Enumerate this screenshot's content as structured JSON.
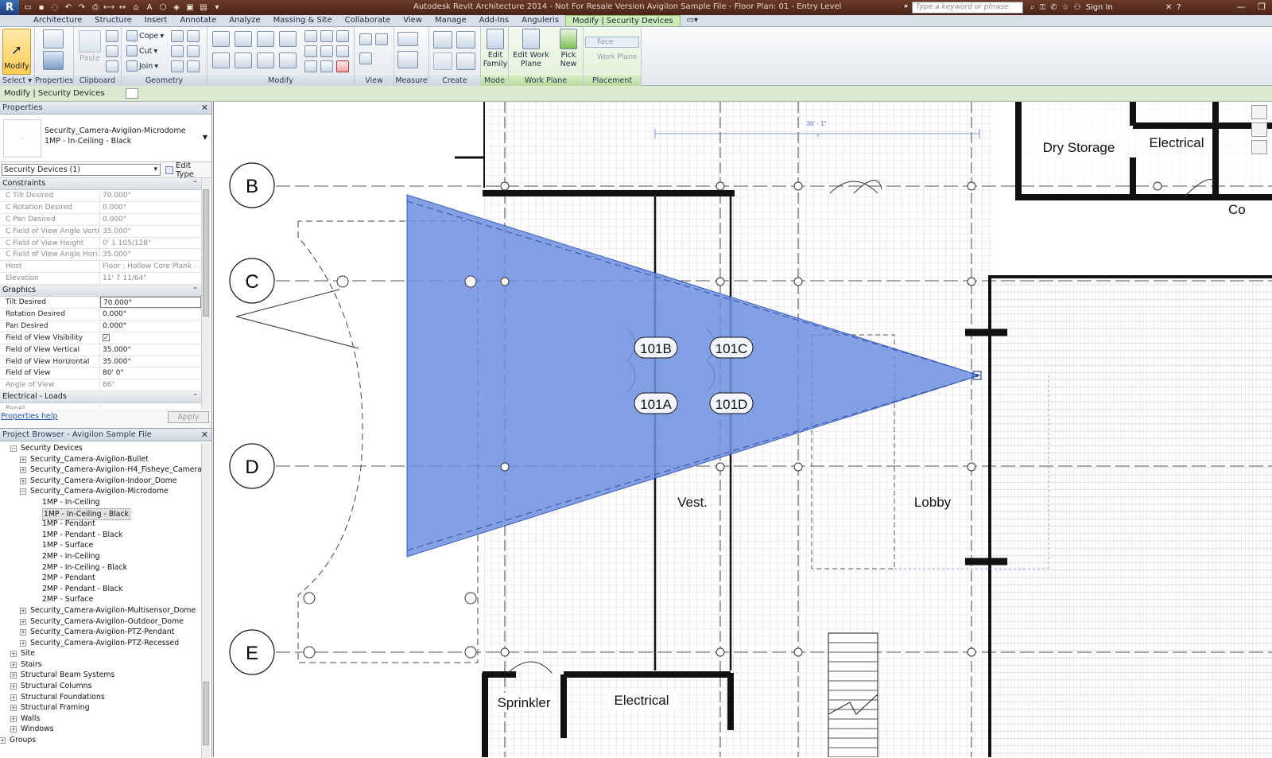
{
  "window": {
    "title": "Autodesk Revit Architecture 2014 - Not For Resale Version    Avigilon Sample File - Floor Plan: 01 - Entry Level",
    "search_placeholder": "Type a keyword or phrase",
    "sign_in": "Sign In"
  },
  "ribbon_tabs": [
    "Architecture",
    "Structure",
    "Insert",
    "Annotate",
    "Analyze",
    "Massing & Site",
    "Collaborate",
    "View",
    "Manage",
    "Add-Ins",
    "Anguleris",
    "Modify | Security Devices"
  ],
  "ribbon": {
    "modify_label": "Modify",
    "select_label": "Select",
    "properties_label": "Properties",
    "clipboard_label": "Clipboard",
    "paste_label": "Paste",
    "cope_label": "Cope",
    "cut_label": "Cut",
    "join_label": "Join",
    "geometry_label": "Geometry",
    "modify_panel_label": "Modify",
    "view_label": "View",
    "measure_label": "Measure",
    "create_label": "Create",
    "edit_family_label": "Edit Family",
    "mode_label": "Mode",
    "edit_work_plane_label": "Edit Work Plane",
    "pick_new_label": "Pick New",
    "work_plane_label": "Work Plane",
    "face_label": "Face",
    "work_plane_btn_label": "Work Plane",
    "placement_label": "Placement"
  },
  "options_bar": {
    "context": "Modify | Security Devices"
  },
  "properties": {
    "title": "Properties",
    "type_name_line1": "Security_Camera-Avigilon-Microdome",
    "type_name_line2": "1MP - In-Ceiling - Black",
    "instance_filter": "Security Devices (1)",
    "edit_type": "Edit Type",
    "groups": [
      {
        "name": "Constraints",
        "rows": [
          {
            "name": "C Tilt Desired",
            "value": "70.000°",
            "readonly": true
          },
          {
            "name": "C Rotation Desired",
            "value": "0.000°",
            "readonly": true
          },
          {
            "name": "C Pan Desired",
            "value": "0.000°",
            "readonly": true
          },
          {
            "name": "C Field of View Angle Verti...",
            "value": "35.000°",
            "readonly": true
          },
          {
            "name": "C Field of View Height",
            "value": "0'  1 105/128\"",
            "readonly": true
          },
          {
            "name": "C Field of View Angle Hori...",
            "value": "35.000°",
            "readonly": true
          },
          {
            "name": "Host",
            "value": "Floor : Hollow Core Plank - ...",
            "readonly": true
          },
          {
            "name": "Elevation",
            "value": "11'  7 11/64\"",
            "readonly": true
          }
        ]
      },
      {
        "name": "Graphics",
        "rows": [
          {
            "name": "Tilt Desired",
            "value": "70.000°",
            "readonly": false,
            "editing": true
          },
          {
            "name": "Rotation Desired",
            "value": "0.000°",
            "readonly": false
          },
          {
            "name": "Pan Desired",
            "value": "0.000°",
            "readonly": false
          },
          {
            "name": "Field of View Visibility",
            "value": "✓",
            "readonly": false,
            "checkbox": true
          },
          {
            "name": "Field of View Vertical",
            "value": "35.000°",
            "readonly": false
          },
          {
            "name": "Field of View Horizontal",
            "value": "35.000°",
            "readonly": false
          },
          {
            "name": "Field of View",
            "value": "80'  0\"",
            "readonly": false
          },
          {
            "name": "Angle of View",
            "value": "86°",
            "readonly": true
          }
        ]
      },
      {
        "name": "Electrical - Loads",
        "rows": [
          {
            "name": "Panel",
            "value": "",
            "readonly": true
          }
        ]
      }
    ],
    "help_link": "Properties help",
    "apply_label": "Apply"
  },
  "project_browser": {
    "title": "Project Browser - Avigilon Sample File",
    "nodes": [
      {
        "label": "Security Devices",
        "level": 1,
        "expander": "−"
      },
      {
        "label": "Security_Camera-Avigilon-Bullet",
        "level": 2,
        "expander": "+"
      },
      {
        "label": "Security_Camera-Avigilon-H4_Fisheye_Camera",
        "level": 2,
        "expander": "+"
      },
      {
        "label": "Security_Camera-Avigilon-Indoor_Dome",
        "level": 2,
        "expander": "+"
      },
      {
        "label": "Security_Camera-Avigilon-Microdome",
        "level": 2,
        "expander": "−"
      },
      {
        "label": "1MP - In-Ceiling",
        "level": 3,
        "expander": ""
      },
      {
        "label": "1MP - In-Ceiling - Black",
        "level": 3,
        "expander": "",
        "selected": true
      },
      {
        "label": "1MP - Pendant",
        "level": 3,
        "expander": ""
      },
      {
        "label": "1MP - Pendant - Black",
        "level": 3,
        "expander": ""
      },
      {
        "label": "1MP - Surface",
        "level": 3,
        "expander": ""
      },
      {
        "label": "2MP - In-Ceiling",
        "level": 3,
        "expander": ""
      },
      {
        "label": "2MP - In-Ceiling - Black",
        "level": 3,
        "expander": ""
      },
      {
        "label": "2MP - Pendant",
        "level": 3,
        "expander": ""
      },
      {
        "label": "2MP - Pendant - Black",
        "level": 3,
        "expander": ""
      },
      {
        "label": "2MP - Surface",
        "level": 3,
        "expander": ""
      },
      {
        "label": "Security_Camera-Avigilon-Multisensor_Dome",
        "level": 2,
        "expander": "+"
      },
      {
        "label": "Security_Camera-Avigilon-Outdoor_Dome",
        "level": 2,
        "expander": "+"
      },
      {
        "label": "Security_Camera-Avigilon-PTZ-Pendant",
        "level": 2,
        "expander": "+"
      },
      {
        "label": "Security_Camera-Avigilon-PTZ-Recessed",
        "level": 2,
        "expander": "+"
      },
      {
        "label": "Site",
        "level": 1,
        "expander": "+"
      },
      {
        "label": "Stairs",
        "level": 1,
        "expander": "+"
      },
      {
        "label": "Structural Beam Systems",
        "level": 1,
        "expander": "+"
      },
      {
        "label": "Structural Columns",
        "level": 1,
        "expander": "+"
      },
      {
        "label": "Structural Foundations",
        "level": 1,
        "expander": "+"
      },
      {
        "label": "Structural Framing",
        "level": 1,
        "expander": "+"
      },
      {
        "label": "Walls",
        "level": 1,
        "expander": "+"
      },
      {
        "label": "Windows",
        "level": 1,
        "expander": "+"
      },
      {
        "label": "Groups",
        "level": 0,
        "expander": "+"
      }
    ]
  },
  "drawing": {
    "grid_bubbles": [
      "B",
      "C",
      "D",
      "E"
    ],
    "rooms": [
      "Dry Storage",
      "Electrical",
      "Co",
      "Vest.",
      "Lobby",
      "Sprinkler",
      "Electrical"
    ],
    "door_tags": [
      "101B",
      "101C",
      "101A",
      "101D"
    ],
    "dimension": "36' - 1\"",
    "fov_color": "#6f8fe0"
  }
}
